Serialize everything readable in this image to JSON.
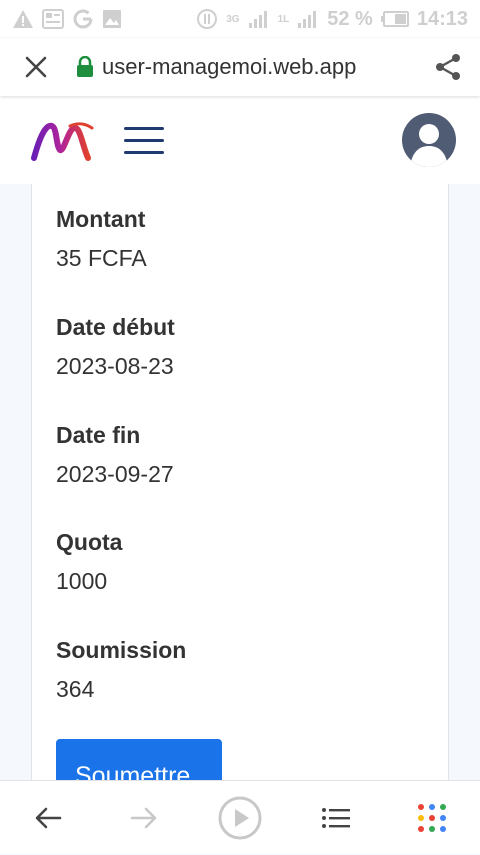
{
  "status_bar": {
    "battery": "52 %",
    "time": "14:13",
    "signal_1": "3G",
    "signal_2": "1L",
    "icons": [
      "warning-icon",
      "news-icon",
      "google-icon",
      "image-icon",
      "data-icon",
      "signal-icon",
      "signal-icon",
      "battery-icon"
    ]
  },
  "browser": {
    "url": "user-managemoi.web.app",
    "close_icon": "close-icon",
    "lock_icon": "lock-icon",
    "lock_color": "#1e8e3e",
    "share_icon": "share-icon"
  },
  "header": {
    "logo_icon": "brand-logo",
    "menu_icon": "hamburger-icon",
    "avatar_icon": "user-avatar-icon",
    "accent": "#1f3a6e"
  },
  "details": {
    "montant_label": "Montant",
    "montant_value": "35 FCFA",
    "date_debut_label": "Date début",
    "date_debut_value": "2023-08-23",
    "date_fin_label": "Date fin",
    "date_fin_value": "2023-09-27",
    "quota_label": "Quota",
    "quota_value": "1000",
    "soumission_label": "Soumission",
    "soumission_value": "364"
  },
  "actions": {
    "submit_label": "Soumettre",
    "submit_color": "#1a73e8"
  },
  "bottom_nav": {
    "icons": [
      "back-arrow-icon",
      "forward-arrow-icon",
      "play-icon",
      "list-icon",
      "apps-icon"
    ]
  }
}
